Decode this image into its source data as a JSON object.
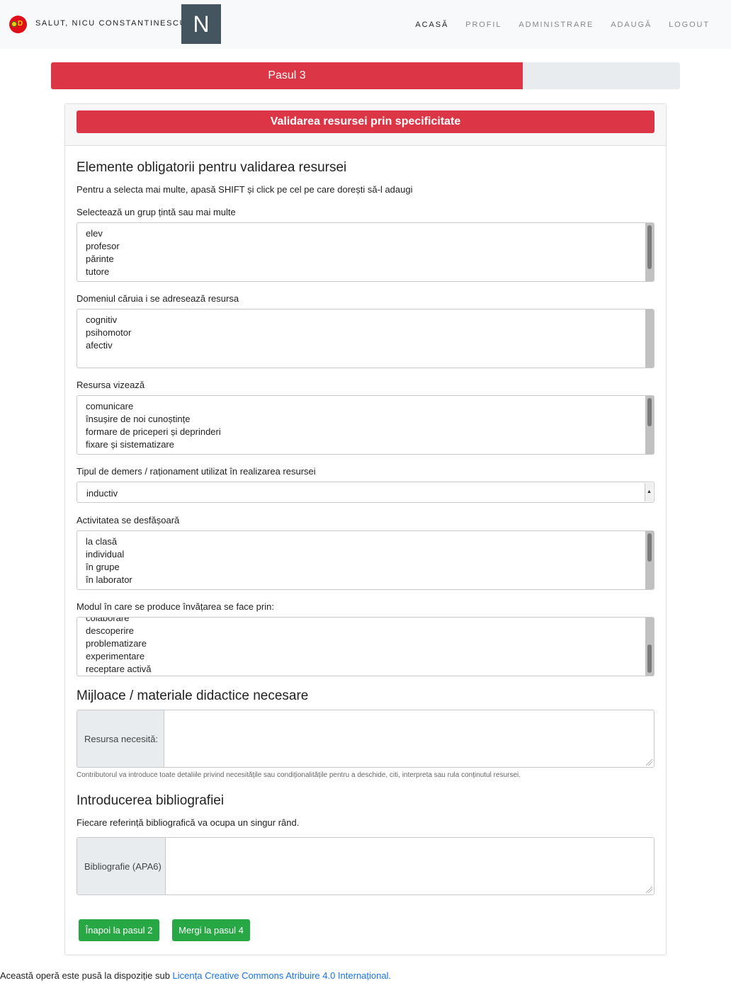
{
  "navbar": {
    "greeting": "SALUT, NICU CONSTANTINESCU",
    "avatar_letter": "N",
    "menu": [
      "ACASĂ",
      "PROFIL",
      "ADMINISTRARE",
      "ADAUGĂ",
      "LOGOUT"
    ],
    "active": "ACASĂ"
  },
  "progress": {
    "label": "Pasul 3",
    "fraction": 0.75
  },
  "card": {
    "title": "Validarea resursei prin specificitate",
    "section1_heading": "Elemente obligatorii pentru validarea resursei",
    "section1_hint": "Pentru a selecta mai multe, apasă SHIFT și click pe cel pe care dorești să-l adaugi",
    "target_group": {
      "label": "Selectează un grup țintă sau mai multe",
      "options": [
        "elev",
        "profesor",
        "părinte",
        "tutore"
      ]
    },
    "domain": {
      "label": "Domeniul căruia i se adresează resursa",
      "options": [
        "cognitiv",
        "psihomotor",
        "afectiv"
      ]
    },
    "targets": {
      "label": "Resursa vizează",
      "options": [
        "comunicare",
        "însușire de noi cunoștințe",
        "formare de priceperi și deprinderi",
        "fixare și sistematizare"
      ]
    },
    "reasoning": {
      "label": "Tipul de demers / raționament utilizat în realizarea resursei",
      "value": "inductiv"
    },
    "activity": {
      "label": "Activitatea se desfășoară",
      "options": [
        "la clasă",
        "individual",
        "în grupe",
        "în laborator"
      ]
    },
    "learning_mode": {
      "label": "Modul în care se produce învățarea se face prin:",
      "options": [
        "colaborare",
        "descoperire",
        "problematizare",
        "experimentare",
        "receptare activă"
      ]
    },
    "materials": {
      "heading": "Mijloace / materiale didactice necesare",
      "addon": "Resursa necesită:",
      "value": "",
      "help": "Contributorul va introduce toate detaliile privind necesitățile sau condiționalitățile pentru a deschide, citi, interpreta sau rula conținutul resursei."
    },
    "bibliography": {
      "heading": "Introducerea bibliografiei",
      "hint": "Fiecare referință bibliografică va ocupa un singur rând.",
      "addon": "Bibliografie (APA6)",
      "value": ""
    },
    "buttons": {
      "back": "Înapoi la pasul 2",
      "next": "Mergi la pasul 4"
    }
  },
  "footer": {
    "text": "Această operă este pusă la dispoziție sub ",
    "link": "Licența Creative Commons Atribuire 4.0 Internațional."
  },
  "colors": {
    "accent": "#dc3545",
    "button": "#28a745",
    "link": "#1a73e8"
  },
  "icons": {
    "brand": "brand-logo-icon"
  }
}
